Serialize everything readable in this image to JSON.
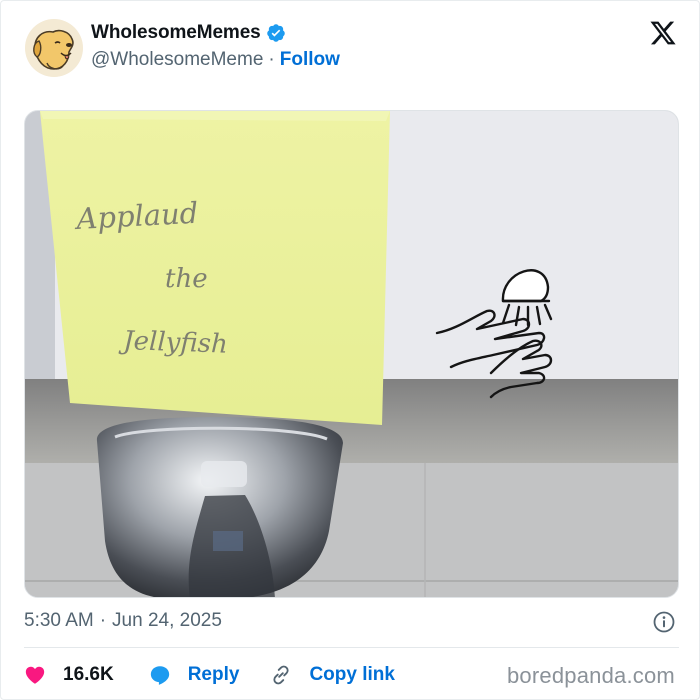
{
  "author": {
    "display_name": "WholesomeMemes",
    "handle": "@WholesomeMeme",
    "separator": "·",
    "follow_label": "Follow",
    "avatar_icon": "dog-avatar-icon",
    "verified_icon": "verified-badge-icon"
  },
  "platform": {
    "logo_icon": "x-logo-icon"
  },
  "media": {
    "note_text": [
      "Applaud",
      "the",
      "Jellyfish"
    ],
    "sticky_note_color": "#edf3a0"
  },
  "post": {
    "time": "5:30 AM",
    "separator": "·",
    "date": "Jun 24, 2025",
    "info_icon": "info-icon"
  },
  "actions": {
    "like_count": "16.6K",
    "reply_label": "Reply",
    "copy_link_label": "Copy link"
  },
  "watermark": "boredpanda.com",
  "colors": {
    "accent": "#006fd6",
    "like": "#f91880",
    "verified": "#1d9bf0",
    "muted": "#536471"
  }
}
